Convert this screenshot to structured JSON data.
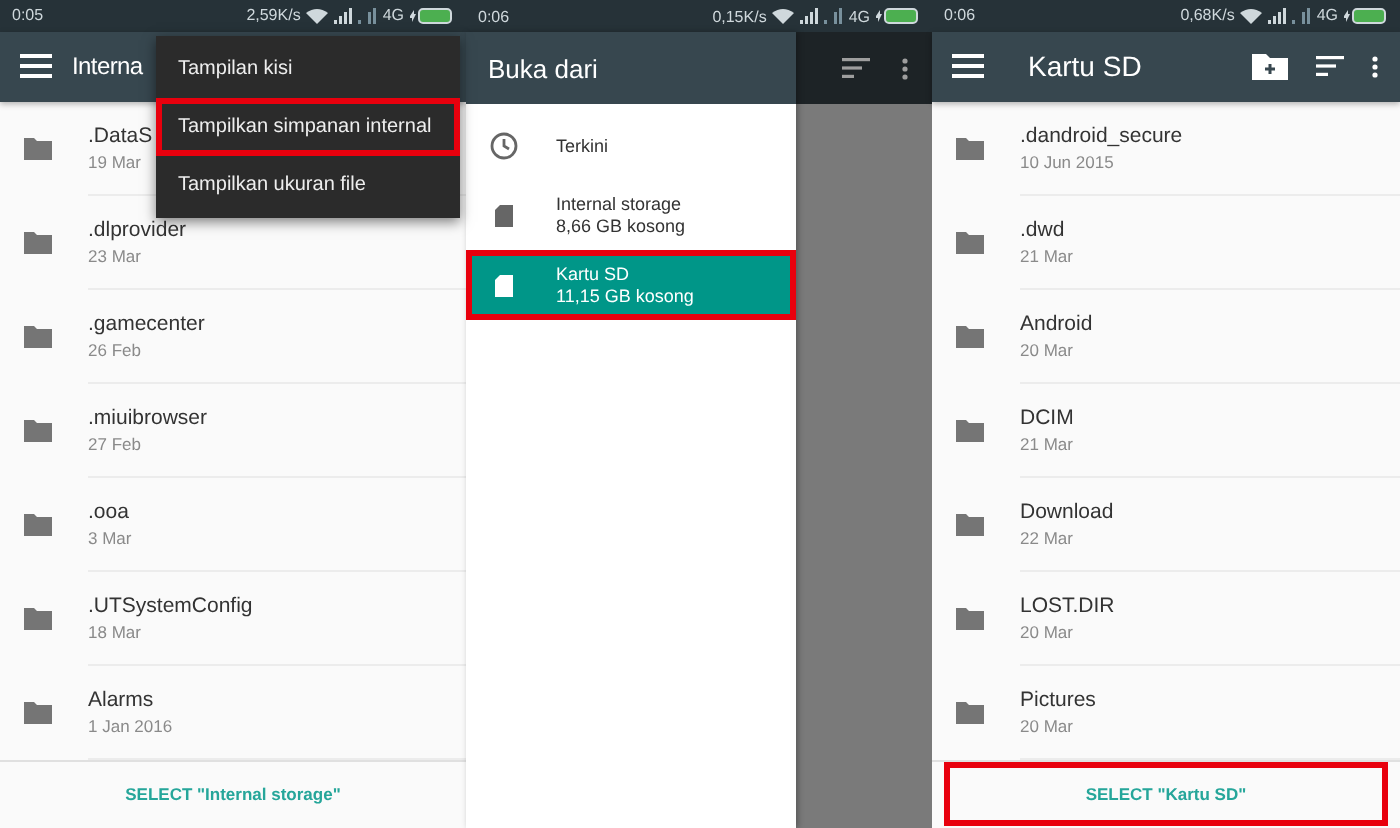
{
  "screens": [
    {
      "status_bar": {
        "time": "0:05",
        "speed": "2,59K/s",
        "network": "4G"
      },
      "app_bar": {
        "title": "Interna"
      },
      "files": [
        {
          "name": ".DataS",
          "date": "19 Mar"
        },
        {
          "name": ".dlprovider",
          "date": "23 Mar"
        },
        {
          "name": ".gamecenter",
          "date": "26 Feb"
        },
        {
          "name": ".miuibrowser",
          "date": "27 Feb"
        },
        {
          "name": ".ooa",
          "date": "3 Mar"
        },
        {
          "name": ".UTSystemConfig",
          "date": "18 Mar"
        },
        {
          "name": "Alarms",
          "date": "1 Jan 2016"
        }
      ],
      "footer": {
        "label": "SELECT \"Internal storage\"",
        "highlighted": false
      },
      "menu": {
        "items": [
          {
            "label": "Tampilan kisi",
            "highlighted": false
          },
          {
            "label": "Tampilkan simpanan internal",
            "highlighted": true
          },
          {
            "label": "Tampilkan ukuran file",
            "highlighted": false
          }
        ]
      }
    },
    {
      "status_bar": {
        "time": "0:06",
        "speed": "0,15K/s",
        "network": "4G"
      },
      "drawer": {
        "title": "Buka dari",
        "items": [
          {
            "kind": "recent",
            "label": "Terkini",
            "selected": false,
            "highlighted": false
          },
          {
            "kind": "storage",
            "label": "Internal storage",
            "sub": "8,66 GB kosong",
            "selected": false,
            "highlighted": false
          },
          {
            "kind": "storage",
            "label": "Kartu SD",
            "sub": "11,15 GB kosong",
            "selected": true,
            "highlighted": true
          }
        ]
      }
    },
    {
      "status_bar": {
        "time": "0:06",
        "speed": "0,68K/s",
        "network": "4G"
      },
      "app_bar": {
        "title": "Kartu SD"
      },
      "files": [
        {
          "name": ".dandroid_secure",
          "date": "10 Jun 2015"
        },
        {
          "name": ".dwd",
          "date": "21 Mar"
        },
        {
          "name": "Android",
          "date": "20 Mar"
        },
        {
          "name": "DCIM",
          "date": "21 Mar"
        },
        {
          "name": "Download",
          "date": "22 Mar"
        },
        {
          "name": "LOST.DIR",
          "date": "20 Mar"
        },
        {
          "name": "Pictures",
          "date": "20 Mar"
        }
      ],
      "footer": {
        "label": "SELECT \"Kartu SD\"",
        "highlighted": true
      }
    }
  ]
}
